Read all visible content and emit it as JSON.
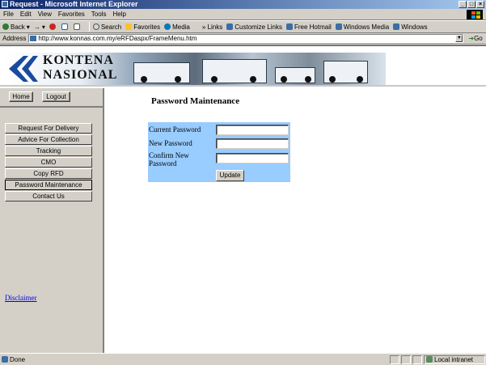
{
  "window": {
    "title": "Request - Microsoft Internet Explorer"
  },
  "menu": [
    "File",
    "Edit",
    "View",
    "Favorites",
    "Tools",
    "Help"
  ],
  "toolbar": {
    "back": "Back",
    "search": "Search",
    "favorites": "Favorites",
    "media": "Media",
    "links": "Links",
    "link_items": [
      "Customize Links",
      "Free Hotmail",
      "Windows Media",
      "Windows"
    ]
  },
  "address": {
    "label": "Address",
    "url": "http://www.konnas.com.my/eRFDaspx/FrameMenu.htm",
    "go": "Go"
  },
  "banner": {
    "brand_line1": "KONTENA",
    "brand_line2": "NASIONAL"
  },
  "sidebar": {
    "home": "Home",
    "logout": "Logout",
    "items": [
      {
        "label": "Request For Delivery"
      },
      {
        "label": "Advice For Collection"
      },
      {
        "label": "Tracking"
      },
      {
        "label": "CMO"
      },
      {
        "label": "Copy RFD"
      },
      {
        "label": "Password Maintenance"
      },
      {
        "label": "Contact Us"
      }
    ],
    "disclaimer": "Disclaimer"
  },
  "main": {
    "heading": "Password Maintenance",
    "fields": {
      "current": "Current Password",
      "new": "New Password",
      "confirm_line1": "Confirm New",
      "confirm_line2": "Password"
    },
    "update": "Update"
  },
  "status": {
    "text": "Done",
    "zone": "Local intranet"
  },
  "colors": {
    "form_bg": "#99ccff",
    "title_start": "#0a246a",
    "link": "#0000ee"
  }
}
